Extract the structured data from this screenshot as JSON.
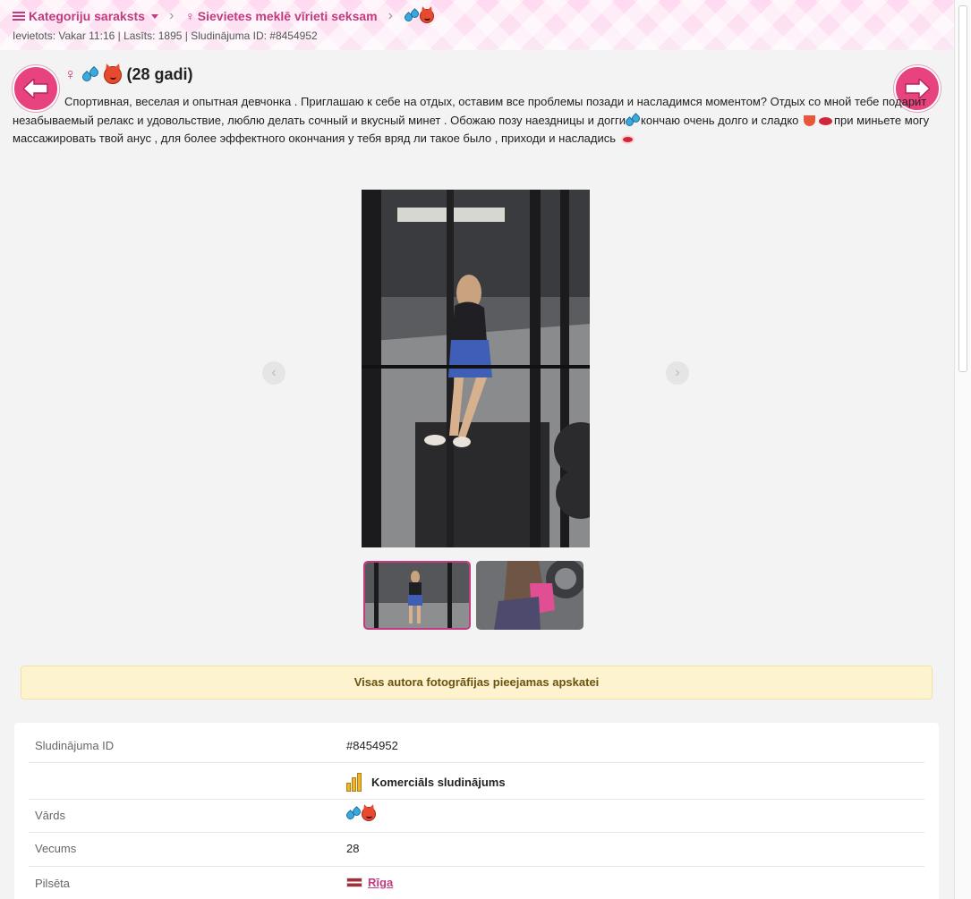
{
  "header": {
    "breadcrumb": {
      "category_list_label": "Kategoriju saraksts",
      "subcategory_label": "Sievietes meklē vīrieti seksam"
    },
    "meta": "Ievietots: Vakar 11:16 | Lasīts: 1895 | Sludinājuma ID: #8454952"
  },
  "listing": {
    "age_title": "(28 gadi)",
    "description": {
      "part1": "Спортивная, веселая и опытная девчонка . Приглашаю к себе на отдых, оставим все проблемы позади и насладимся моментом? Отдых со мной тебе подарит незабываемый релакс и удовольствие, люблю делать сочный и вкусный минет . Обожаю позу наездницы и догги",
      "part2": "кончаю очень долго и сладко ",
      "part3": "при миньете могу массажировать твой анус , для более эффектного окончания ",
      "part4": "у тебя вряд ли такое было , приходи и насладись "
    }
  },
  "gallery": {
    "prev_glyph": "‹",
    "next_glyph": "›",
    "active_thumb_index": 0
  },
  "notice": {
    "text": "Visas autora fotogrāfijas pieejamas apskatei"
  },
  "details": {
    "id_label": "Sludinājuma ID",
    "id_value": "#8454952",
    "commercial_label": "Komerciāls sludinājums",
    "name_label": "Vārds",
    "age_label": "Vecums",
    "age_value": "28",
    "city_label": "Pilsēta",
    "city_value": "Rīga"
  },
  "colors": {
    "accent": "#c23a7f",
    "nav_button": "#e8437f",
    "notice_bg": "#fdf3cf"
  },
  "icons": [
    "list-icon",
    "caret-down-icon",
    "venus-icon",
    "sweat-drops-icon",
    "devil-face-icon",
    "arrow-left-icon",
    "arrow-right-icon",
    "bar-chart-icon",
    "latvia-flag-icon",
    "lips-icon",
    "tongue-icon"
  ]
}
